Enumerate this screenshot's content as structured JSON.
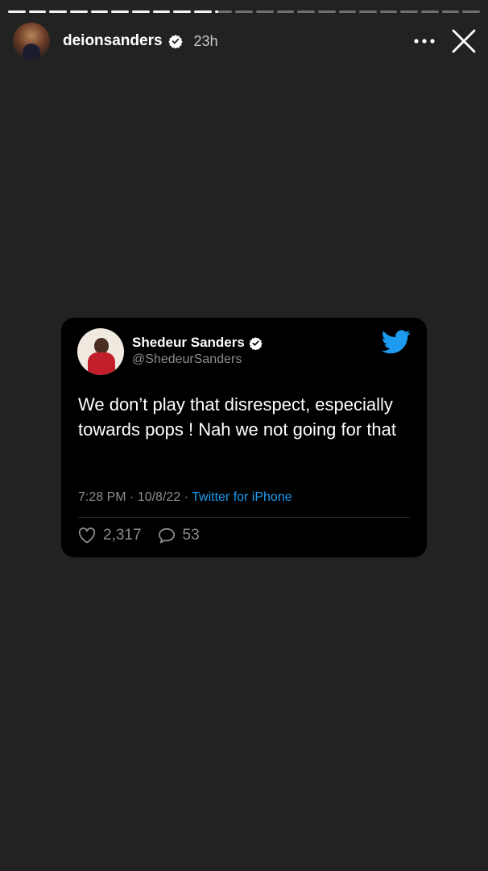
{
  "story": {
    "progress": {
      "segments_total": 23,
      "segments_complete": 10,
      "current_segment_fraction": 0.2
    },
    "header": {
      "username": "deionsanders",
      "time_ago": "23h",
      "icons": [
        "avatar",
        "verified-badge-icon",
        "more-options-icon",
        "close-icon"
      ]
    }
  },
  "tweet": {
    "author_name": "Shedeur Sanders",
    "author_handle": "@ShedeurSanders",
    "text": "We don’t play that disrespect, especially towards pops ! Nah we not going for that",
    "timestamp": "7:28 PM · 10/8/22 · ",
    "source": "Twitter for iPhone",
    "likes": "2,317",
    "replies": "53",
    "colors": {
      "accent": "#1d9bf0",
      "card_bg": "#000000",
      "muted": "#8b8b8b"
    },
    "icons": [
      "twitter-bird-icon",
      "verified-badge-icon",
      "heart-icon",
      "reply-bubble-icon"
    ]
  },
  "colors": {
    "background": "#222222",
    "text": "#ffffff"
  }
}
